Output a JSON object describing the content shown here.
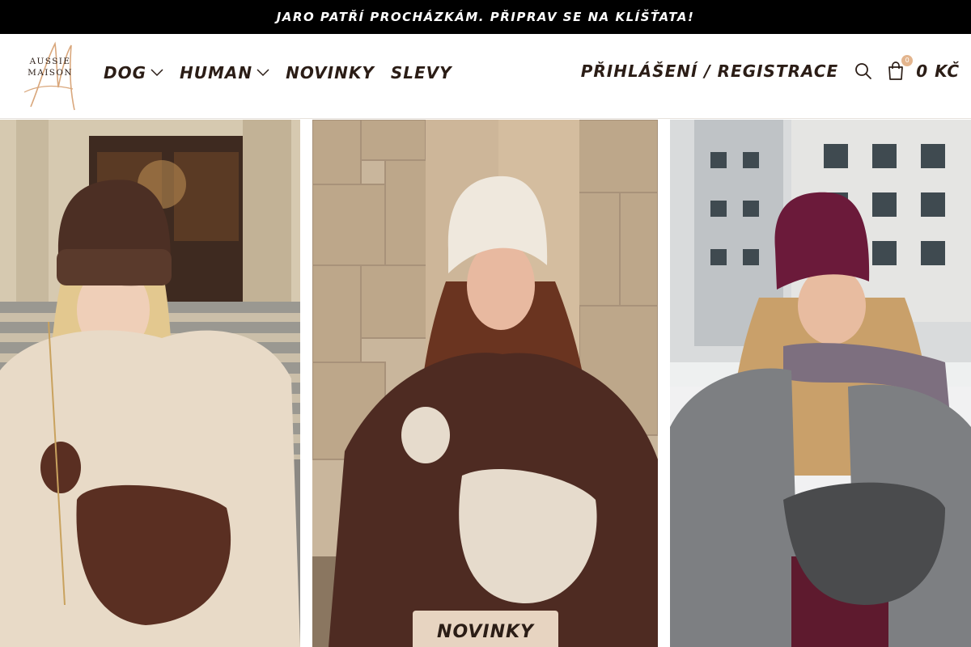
{
  "announcement": {
    "text": "Jaro patří procházkám. Připrav se na klíšťata!"
  },
  "logo": {
    "line1": "AUSSIE",
    "line2": "MAISON"
  },
  "nav": [
    {
      "label": "DOG",
      "dropdown": true
    },
    {
      "label": "HUMAN",
      "dropdown": true
    },
    {
      "label": "NOVINKY",
      "dropdown": false
    },
    {
      "label": "SLEVY",
      "dropdown": false
    }
  ],
  "header_right": {
    "login_label": "PŘIHLÁŠENÍ / REGISTRACE",
    "cart_count": "0",
    "cart_total": "0 KČ"
  },
  "hero": {
    "cta_label": "NOVINKY",
    "photos": [
      {
        "name": "model-brown-beanie-beige-fleece"
      },
      {
        "name": "model-cream-beanie-brown-fleece"
      },
      {
        "name": "model-burgundy-beanie-grey-coat"
      }
    ]
  },
  "colors": {
    "announcement_bg": "#000000",
    "text": "#2b1d16",
    "accent": "#e3b58e",
    "cta_bg": "#e7d4c1"
  },
  "icons": [
    "chevron-down-icon",
    "search-icon",
    "shopping-bag-icon"
  ]
}
